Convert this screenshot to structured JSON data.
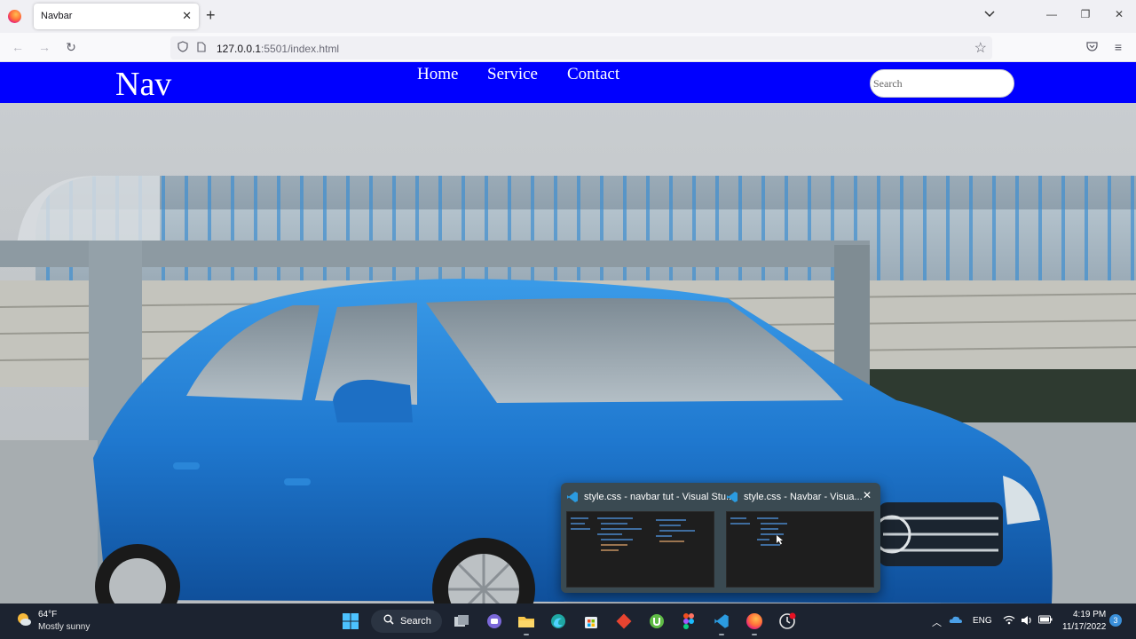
{
  "browser": {
    "tab_title": "Navbar",
    "url_host": "127.0.0.1",
    "url_rest": ":5501/index.html"
  },
  "site": {
    "logo": "Nav",
    "menu": [
      "Home",
      "Service",
      "Contact"
    ],
    "search_placeholder": "Search",
    "nav_color": "#0000ff",
    "hero_subject": "blue-hatchback-car"
  },
  "preview": {
    "windows": [
      {
        "title": "style.css - navbar tut - Visual Stu..."
      },
      {
        "title": "style.css - Navbar - Visua..."
      }
    ]
  },
  "taskbar": {
    "weather_temp": "64°F",
    "weather_condition": "Mostly sunny",
    "search_label": "Search",
    "language": "ENG",
    "time": "4:19 PM",
    "date": "11/17/2022",
    "notification_count": "3"
  }
}
